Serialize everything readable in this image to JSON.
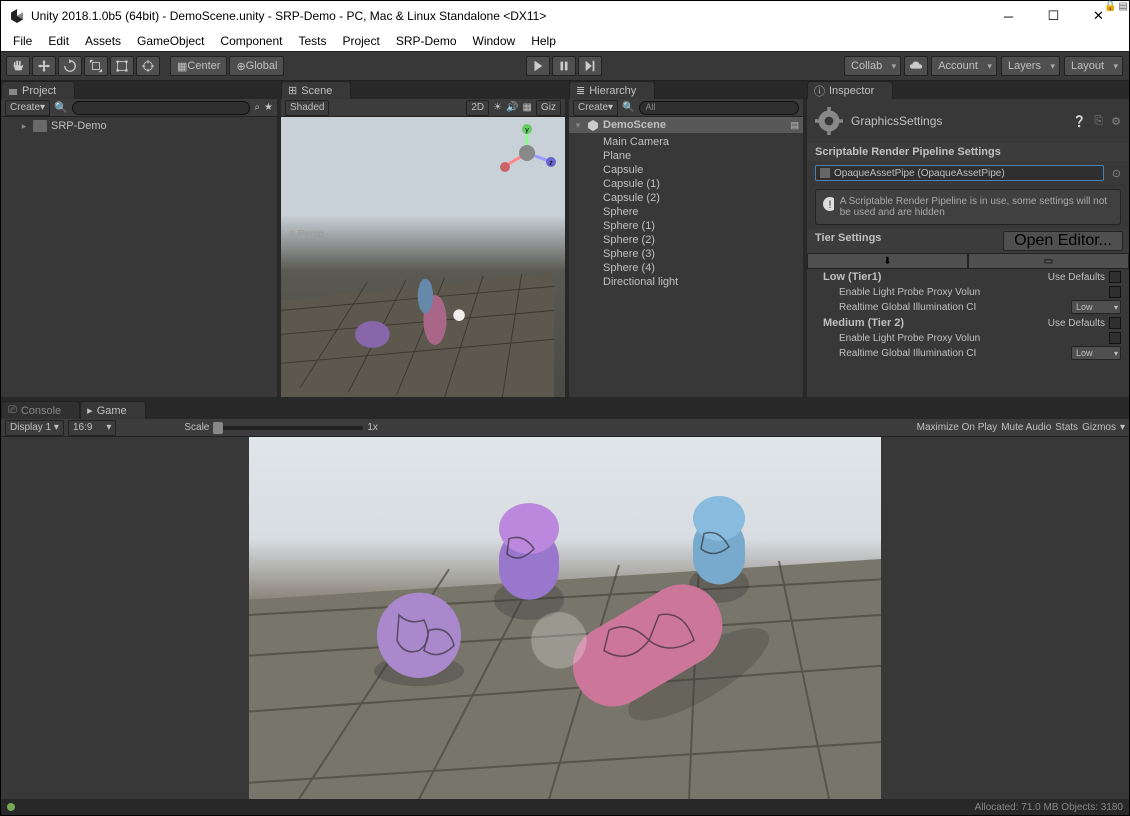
{
  "window": {
    "title": "Unity 2018.1.0b5 (64bit) - DemoScene.unity - SRP-Demo - PC, Mac & Linux Standalone <DX11>"
  },
  "menu": [
    "File",
    "Edit",
    "Assets",
    "GameObject",
    "Component",
    "Tests",
    "Project",
    "SRP-Demo",
    "Window",
    "Help"
  ],
  "toolbar": {
    "center": "Center",
    "global": "Global",
    "collab": "Collab",
    "account": "Account",
    "layers": "Layers",
    "layout": "Layout"
  },
  "project": {
    "tab": "Project",
    "create": "Create",
    "root": "SRP-Demo"
  },
  "scene": {
    "tab": "Scene",
    "shaded": "Shaded",
    "mode2d": "2D",
    "giz": "Giz",
    "persp": "Persp"
  },
  "hierarchy": {
    "tab": "Hierarchy",
    "create": "Create",
    "search": "All",
    "scene_name": "DemoScene",
    "items": [
      "Main Camera",
      "Plane",
      "Capsule",
      "Capsule (1)",
      "Capsule (2)",
      "Sphere",
      "Sphere (1)",
      "Sphere (2)",
      "Sphere (3)",
      "Sphere (4)",
      "Directional light"
    ]
  },
  "inspector": {
    "tab": "Inspector",
    "title": "GraphicsSettings",
    "section1": "Scriptable Render Pipeline Settings",
    "pipeline": "OpaqueAssetPipe (OpaqueAssetPipe)",
    "info": "A Scriptable Render Pipeline is in use, some settings will not be used and are hidden",
    "tier_settings": "Tier Settings",
    "open_editor": "Open Editor...",
    "tier1": "Low (Tier1)",
    "tier2": "Medium (Tier 2)",
    "use_defaults": "Use Defaults",
    "prop1": "Enable Light Probe Proxy Volun",
    "prop2": "Realtime Global Illumination CI",
    "low": "Low"
  },
  "console": {
    "tab": "Console"
  },
  "game": {
    "tab": "Game",
    "display": "Display 1",
    "aspect": "16:9",
    "scale": "Scale",
    "scaleval": "1x",
    "maximize": "Maximize On Play",
    "mute": "Mute Audio",
    "stats": "Stats",
    "gizmos": "Gizmos"
  },
  "status": {
    "allocated": "Allocated: 71.0 MB Objects: 3180"
  }
}
